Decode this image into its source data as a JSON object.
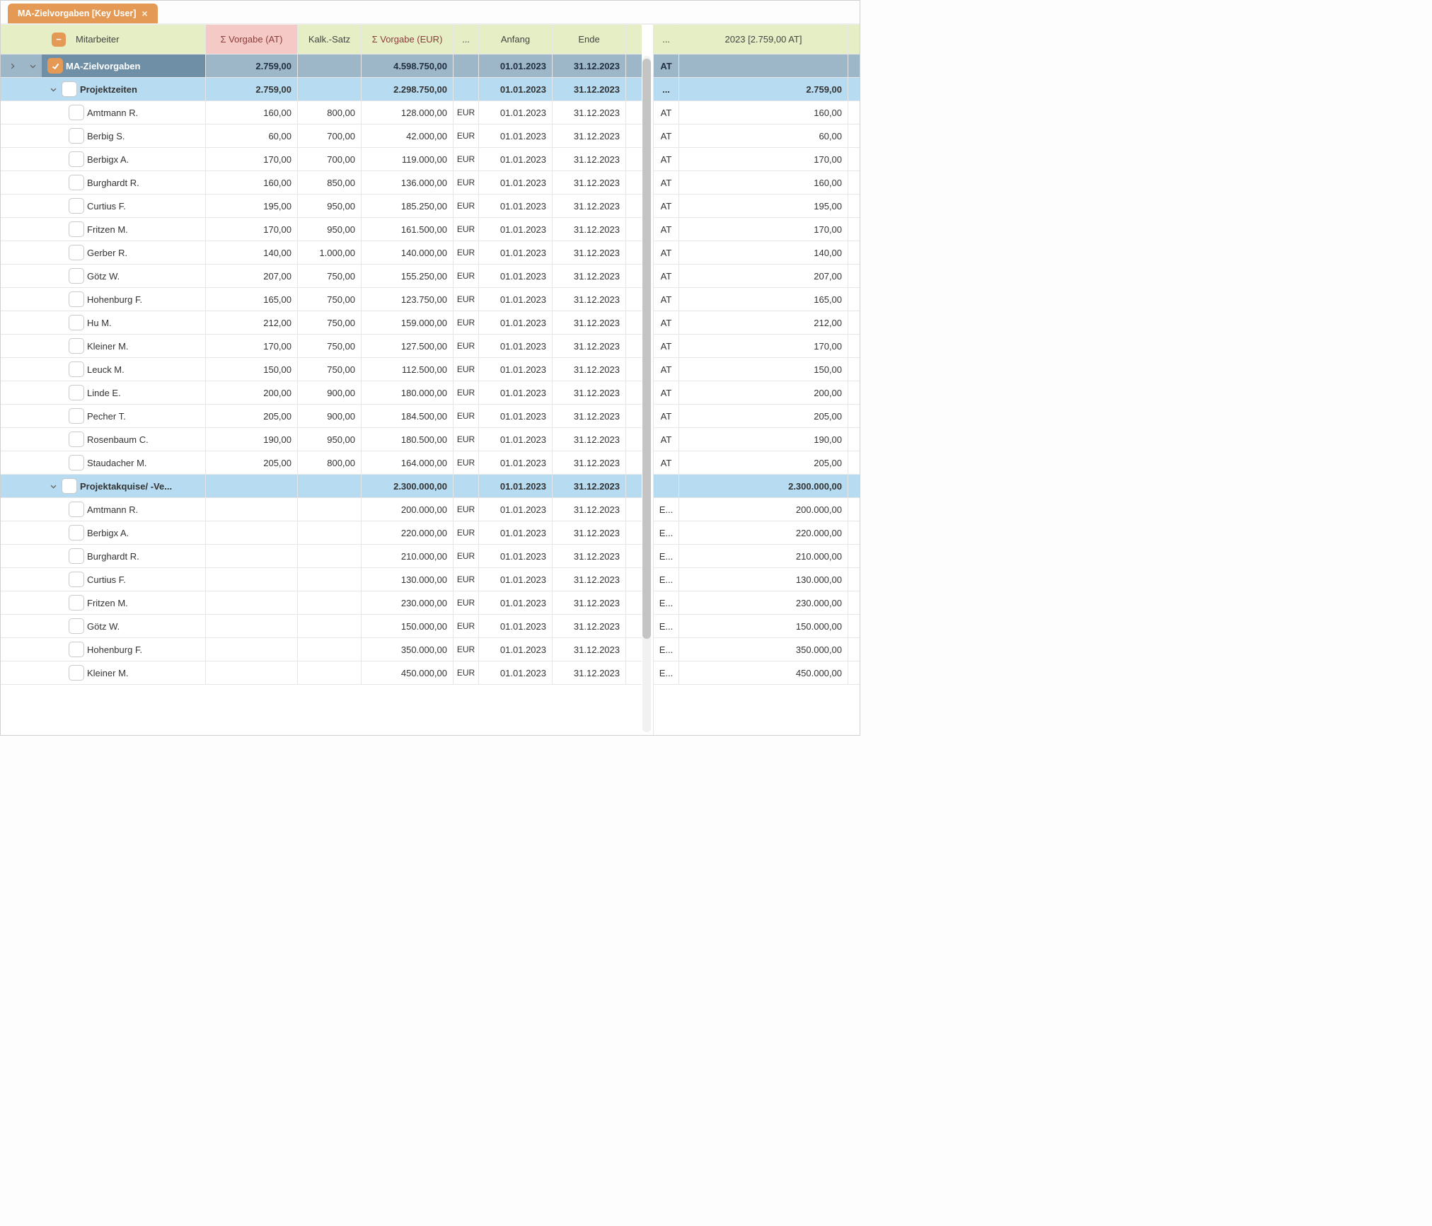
{
  "tab": {
    "title": "MA-Zielvorgaben [Key User]"
  },
  "left": {
    "headers": {
      "mitarbeiter": "Mitarbeiter",
      "vorgabe_at": "Σ Vorgabe (AT)",
      "kalk_satz": "Kalk.-Satz",
      "vorgabe_eur": "Σ Vorgabe (EUR)",
      "unit": "...",
      "anfang": "Anfang",
      "ende": "Ende"
    },
    "total": {
      "label": "MA-Zielvorgaben",
      "vorgabe_at": "2.759,00",
      "vorgabe_eur": "4.598.750,00",
      "anfang": "01.01.2023",
      "ende": "31.12.2023"
    },
    "groups": [
      {
        "label": "Projektzeiten",
        "vorgabe_at": "2.759,00",
        "vorgabe_eur": "2.298.750,00",
        "anfang": "01.01.2023",
        "ende": "31.12.2023",
        "rows": [
          {
            "name": "Amtmann R.",
            "at": "160,00",
            "satz": "800,00",
            "eur": "128.000,00",
            "cur": "EUR",
            "a": "01.01.2023",
            "e": "31.12.2023"
          },
          {
            "name": "Berbig S.",
            "at": "60,00",
            "satz": "700,00",
            "eur": "42.000,00",
            "cur": "EUR",
            "a": "01.01.2023",
            "e": "31.12.2023"
          },
          {
            "name": "Berbigx A.",
            "at": "170,00",
            "satz": "700,00",
            "eur": "119.000,00",
            "cur": "EUR",
            "a": "01.01.2023",
            "e": "31.12.2023"
          },
          {
            "name": "Burghardt R.",
            "at": "160,00",
            "satz": "850,00",
            "eur": "136.000,00",
            "cur": "EUR",
            "a": "01.01.2023",
            "e": "31.12.2023"
          },
          {
            "name": "Curtius F.",
            "at": "195,00",
            "satz": "950,00",
            "eur": "185.250,00",
            "cur": "EUR",
            "a": "01.01.2023",
            "e": "31.12.2023"
          },
          {
            "name": "Fritzen M.",
            "at": "170,00",
            "satz": "950,00",
            "eur": "161.500,00",
            "cur": "EUR",
            "a": "01.01.2023",
            "e": "31.12.2023"
          },
          {
            "name": "Gerber R.",
            "at": "140,00",
            "satz": "1.000,00",
            "eur": "140.000,00",
            "cur": "EUR",
            "a": "01.01.2023",
            "e": "31.12.2023"
          },
          {
            "name": "Götz W.",
            "at": "207,00",
            "satz": "750,00",
            "eur": "155.250,00",
            "cur": "EUR",
            "a": "01.01.2023",
            "e": "31.12.2023"
          },
          {
            "name": "Hohenburg F.",
            "at": "165,00",
            "satz": "750,00",
            "eur": "123.750,00",
            "cur": "EUR",
            "a": "01.01.2023",
            "e": "31.12.2023"
          },
          {
            "name": "Hu M.",
            "at": "212,00",
            "satz": "750,00",
            "eur": "159.000,00",
            "cur": "EUR",
            "a": "01.01.2023",
            "e": "31.12.2023"
          },
          {
            "name": "Kleiner M.",
            "at": "170,00",
            "satz": "750,00",
            "eur": "127.500,00",
            "cur": "EUR",
            "a": "01.01.2023",
            "e": "31.12.2023"
          },
          {
            "name": "Leuck M.",
            "at": "150,00",
            "satz": "750,00",
            "eur": "112.500,00",
            "cur": "EUR",
            "a": "01.01.2023",
            "e": "31.12.2023"
          },
          {
            "name": "Linde E.",
            "at": "200,00",
            "satz": "900,00",
            "eur": "180.000,00",
            "cur": "EUR",
            "a": "01.01.2023",
            "e": "31.12.2023"
          },
          {
            "name": "Pecher T.",
            "at": "205,00",
            "satz": "900,00",
            "eur": "184.500,00",
            "cur": "EUR",
            "a": "01.01.2023",
            "e": "31.12.2023"
          },
          {
            "name": "Rosenbaum C.",
            "at": "190,00",
            "satz": "950,00",
            "eur": "180.500,00",
            "cur": "EUR",
            "a": "01.01.2023",
            "e": "31.12.2023"
          },
          {
            "name": "Staudacher M.",
            "at": "205,00",
            "satz": "800,00",
            "eur": "164.000,00",
            "cur": "EUR",
            "a": "01.01.2023",
            "e": "31.12.2023"
          }
        ]
      },
      {
        "label": "Projektakquise/ -Ve...",
        "vorgabe_at": "",
        "vorgabe_eur": "2.300.000,00",
        "anfang": "01.01.2023",
        "ende": "31.12.2023",
        "rows": [
          {
            "name": "Amtmann R.",
            "at": "",
            "satz": "",
            "eur": "200.000,00",
            "cur": "EUR",
            "a": "01.01.2023",
            "e": "31.12.2023"
          },
          {
            "name": "Berbigx A.",
            "at": "",
            "satz": "",
            "eur": "220.000,00",
            "cur": "EUR",
            "a": "01.01.2023",
            "e": "31.12.2023"
          },
          {
            "name": "Burghardt R.",
            "at": "",
            "satz": "",
            "eur": "210.000,00",
            "cur": "EUR",
            "a": "01.01.2023",
            "e": "31.12.2023"
          },
          {
            "name": "Curtius F.",
            "at": "",
            "satz": "",
            "eur": "130.000,00",
            "cur": "EUR",
            "a": "01.01.2023",
            "e": "31.12.2023"
          },
          {
            "name": "Fritzen M.",
            "at": "",
            "satz": "",
            "eur": "230.000,00",
            "cur": "EUR",
            "a": "01.01.2023",
            "e": "31.12.2023"
          },
          {
            "name": "Götz W.",
            "at": "",
            "satz": "",
            "eur": "150.000,00",
            "cur": "EUR",
            "a": "01.01.2023",
            "e": "31.12.2023"
          },
          {
            "name": "Hohenburg F.",
            "at": "",
            "satz": "",
            "eur": "350.000,00",
            "cur": "EUR",
            "a": "01.01.2023",
            "e": "31.12.2023"
          },
          {
            "name": "Kleiner M.",
            "at": "",
            "satz": "",
            "eur": "450.000,00",
            "cur": "EUR",
            "a": "01.01.2023",
            "e": "31.12.2023"
          }
        ]
      }
    ]
  },
  "right": {
    "headers": {
      "unit": "...",
      "year": "2023 [2.759,00 AT]"
    },
    "at_row": {
      "unit": "AT",
      "value": ""
    },
    "rows": [
      {
        "u": "...",
        "v": "2.759,00",
        "hl": true
      },
      {
        "u": "AT",
        "v": "160,00"
      },
      {
        "u": "AT",
        "v": "60,00"
      },
      {
        "u": "AT",
        "v": "170,00"
      },
      {
        "u": "AT",
        "v": "160,00"
      },
      {
        "u": "AT",
        "v": "195,00"
      },
      {
        "u": "AT",
        "v": "170,00"
      },
      {
        "u": "AT",
        "v": "140,00"
      },
      {
        "u": "AT",
        "v": "207,00"
      },
      {
        "u": "AT",
        "v": "165,00"
      },
      {
        "u": "AT",
        "v": "212,00"
      },
      {
        "u": "AT",
        "v": "170,00"
      },
      {
        "u": "AT",
        "v": "150,00"
      },
      {
        "u": "AT",
        "v": "200,00"
      },
      {
        "u": "AT",
        "v": "205,00"
      },
      {
        "u": "AT",
        "v": "190,00"
      },
      {
        "u": "AT",
        "v": "205,00"
      },
      {
        "u": "",
        "v": "2.300.000,00",
        "hl": true
      },
      {
        "u": "E...",
        "v": "200.000,00"
      },
      {
        "u": "E...",
        "v": "220.000,00"
      },
      {
        "u": "E...",
        "v": "210.000,00"
      },
      {
        "u": "E...",
        "v": "130.000,00"
      },
      {
        "u": "E...",
        "v": "230.000,00"
      },
      {
        "u": "E...",
        "v": "150.000,00"
      },
      {
        "u": "E...",
        "v": "350.000,00"
      },
      {
        "u": "E...",
        "v": "450.000,00"
      }
    ]
  }
}
